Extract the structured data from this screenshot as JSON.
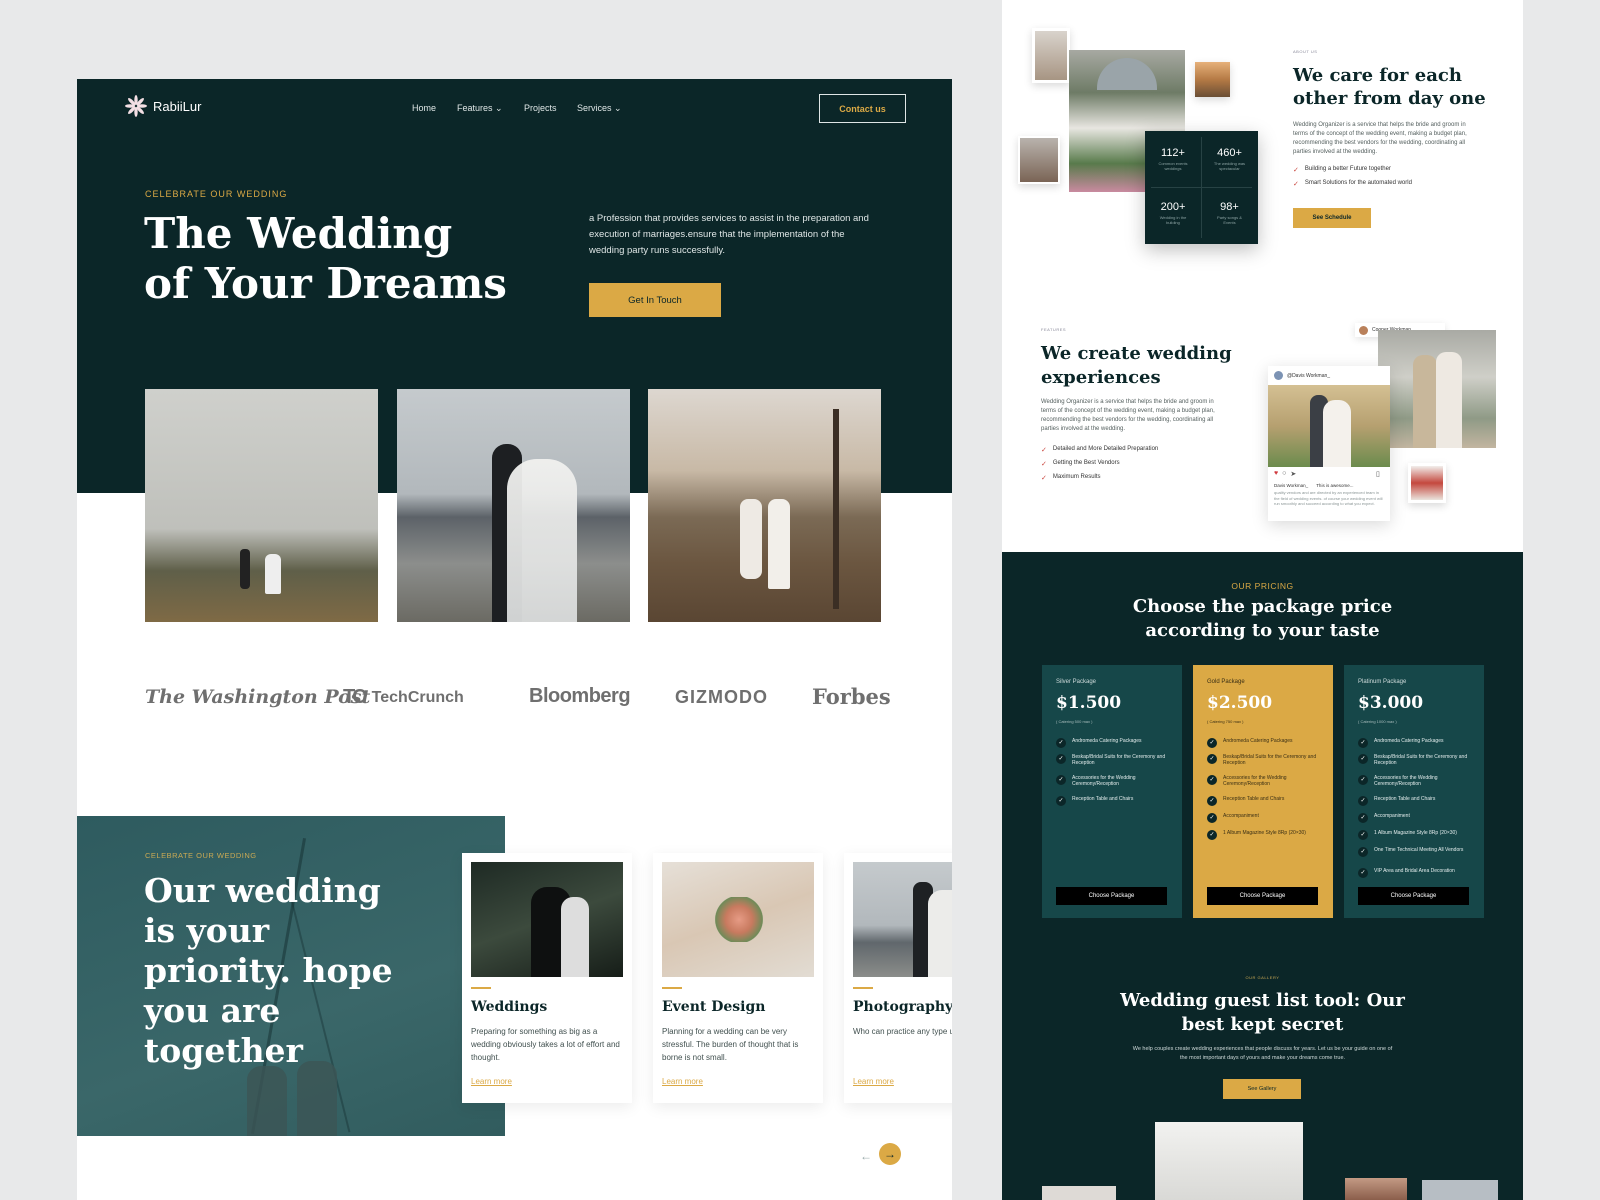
{
  "left": {
    "brand": "RabiiLur",
    "nav": {
      "home": "Home",
      "features": "Features",
      "projects": "Projects",
      "services": "Services",
      "contact": "Contact us"
    },
    "hero": {
      "eyebrow": "CELEBRATE OUR WEDDING",
      "title_line1": "The Wedding",
      "title_line2": "of Your Dreams",
      "description": "a Profession that provides services to assist in the preparation and execution of marriages.ensure that the implementation of the wedding party runs successfully.",
      "cta": "Get In Touch"
    },
    "press": {
      "washington_post": "The Washington Post",
      "techcrunch": "TechCrunch",
      "bloomberg": "Bloomberg",
      "gizmodo": "GIZMODO",
      "forbes": "Forbes"
    },
    "priority": {
      "eyebrow": "CELEBRATE OUR WEDDING",
      "title": "Our wedding is your priority. hope you are together"
    },
    "cards": [
      {
        "title": "Weddings",
        "text": "Preparing for something as big as a wedding obviously takes a lot of effort and thought.",
        "link": "Learn more"
      },
      {
        "title": "Event Design",
        "text": "Planning for a wedding can be very stressful. The burden of thought that is borne is not small.",
        "link": "Learn more"
      },
      {
        "title": "Photography",
        "text": "Who can practice any type unless it is beneficial for the person? Duis or Iru",
        "link": "Learn more"
      }
    ],
    "carousel": {
      "prev_icon": "arrow-left-icon",
      "next_icon": "arrow-right-icon"
    }
  },
  "right": {
    "about": {
      "eyebrow": "ABOUT US",
      "title_line1": "We care for each",
      "title_line2": "other from day one",
      "text": "Wedding Organizer is a service that helps the bride and groom in terms of the concept of the wedding event, making a budget plan, recommending the best vendors for the wedding, coordinating all parties involved at the wedding.",
      "bullets": [
        "Building a better Future together",
        "Smart Solutions for the automated world"
      ],
      "cta": "See Schedule"
    },
    "stats": [
      {
        "value": "112+",
        "label": "Common events weddings"
      },
      {
        "value": "460+",
        "label": "The wedding was spectacular"
      },
      {
        "value": "200+",
        "label": "Wedding in the building"
      },
      {
        "value": "98+",
        "label": "Party songs & Events"
      }
    ],
    "features": {
      "eyebrow": "FEATURES",
      "title_line1": "We create wedding",
      "title_line2": "experiences",
      "text": "Wedding Organizer is a service that helps the bride and groom in terms of the concept of the wedding event, making a budget plan, recommending the best vendors for the wedding, coordinating all parties involved at the wedding.",
      "bullets": [
        "Detailed and More Detailed Preparation",
        "Getting the Best Vendors",
        "Maximum Results"
      ],
      "social_user1": "Cooper Workman",
      "social_user2": "@Davis Workman_",
      "post_caption_user": "Davis Workman_",
      "post_caption": "This is awesome...",
      "post_text": "quality vendors and are directed by an experienced team in the field of wedding events. of course your wedding event will run smoothly and succeed according to what you expect."
    },
    "pricing": {
      "eyebrow": "OUR PRICING",
      "title_line1": "Choose the package price",
      "title_line2": "according to your taste",
      "packages": [
        {
          "name": "Silver Package",
          "price": "$1.500",
          "note": "( Catering 500 max )",
          "features": [
            "Andromeda Catering Packages",
            "Beskap/Bridal Suits for the Ceremony and Reception",
            "Accessories for the Wedding Ceremony/Reception",
            "Reception Table and Chairs"
          ],
          "cta": "Choose Package"
        },
        {
          "name": "Gold Package",
          "price": "$2.500",
          "note": "( Catering 750 max )",
          "features": [
            "Andromeda Catering Packages",
            "Beskap/Bridal Suits for the Ceremony and Reception",
            "Accessories for the Wedding Ceremony/Reception",
            "Reception Table and Chairs",
            "Accompaniment",
            "1 Album Magazine Style 8Rp (20×30)"
          ],
          "cta": "Choose Package"
        },
        {
          "name": "Platinum Package",
          "price": "$3.000",
          "note": "( Catering 1000 max )",
          "features": [
            "Andromeda Catering Packages",
            "Beskap/Bridal Suits for the Ceremony and Reception",
            "Accessories for the Wedding Ceremony/Reception",
            "Reception Table and Chairs",
            "Accompaniment",
            "1 Album Magazine Style 8Rp (20×30)",
            "One Time Technical Meeting All Vendors",
            "VIP Area and Bridal Area Decoration"
          ],
          "cta": "Choose Package"
        }
      ]
    },
    "gallery": {
      "eyebrow": "OUR GALLERY",
      "title_line1": "Wedding guest list tool: Our",
      "title_line2": "best kept secret",
      "text": "We help couples create wedding experiences that people discuss for years. Let us be your guide on one of the most important days of yours and make your dreams come true.",
      "cta": "See Gallery"
    }
  },
  "colors": {
    "dark": "#0b2628",
    "teal": "#164749",
    "gold": "#dba945"
  }
}
